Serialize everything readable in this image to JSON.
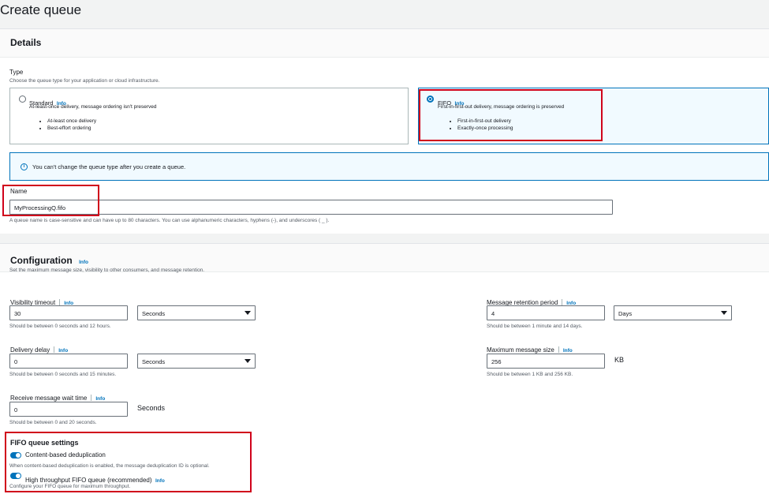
{
  "page_title": "Create queue",
  "details": {
    "heading": "Details",
    "type_label": "Type",
    "type_hint": "Choose the queue type for your application or cloud infrastructure.",
    "standard": {
      "title": "Standard",
      "info": "Info",
      "description": "At-least-once delivery, message ordering isn't preserved",
      "bullets": [
        "At-least once delivery",
        "Best-effort ordering"
      ]
    },
    "fifo": {
      "title": "FIFO",
      "info": "Info",
      "description": "First-in-first-out delivery, message ordering is preserved",
      "bullets": [
        "First-in-first-out delivery",
        "Exactly-once processing"
      ]
    },
    "alert_text": "You can't change the queue type after you create a queue.",
    "name_label": "Name",
    "name_value": "MyProcessingQ.fifo",
    "name_hint": "A queue name is case-sensitive and can have up to 80 characters. You can use alphanumeric characters, hyphens (-), and underscores ( _ )."
  },
  "configuration": {
    "heading": "Configuration",
    "info": "Info",
    "hint": "Set the maximum message size, visibility to other consumers, and message retention.",
    "visibility_timeout": {
      "label": "Visibility timeout",
      "info": "Info",
      "value": "30",
      "unit": "Seconds",
      "hint": "Should be between 0 seconds and 12 hours."
    },
    "delivery_delay": {
      "label": "Delivery delay",
      "info": "Info",
      "value": "0",
      "unit": "Seconds",
      "hint": "Should be between 0 seconds and 15 minutes."
    },
    "receive_wait": {
      "label": "Receive message wait time",
      "info": "Info",
      "value": "0",
      "unit": "Seconds",
      "hint": "Should be between 0 and 20 seconds."
    },
    "retention": {
      "label": "Message retention period",
      "info": "Info",
      "value": "4",
      "unit": "Days",
      "hint": "Should be between 1 minute and 14 days."
    },
    "max_size": {
      "label": "Maximum message size",
      "info": "Info",
      "value": "256",
      "unit": "KB",
      "hint": "Should be between 1 KB and 256 KB."
    }
  },
  "fifo_settings": {
    "heading": "FIFO queue settings",
    "content_dedup_label": "Content-based deduplication",
    "content_dedup_hint": "When content-based deduplication is enabled, the message deduplication ID is optional.",
    "high_throughput_label": "High throughput FIFO queue (recommended)",
    "high_throughput_info": "Info",
    "high_throughput_hint": "Configure your FIFO queue for maximum throughput."
  },
  "colors": {
    "accent": "#0073bb",
    "highlight": "#d0021b"
  }
}
